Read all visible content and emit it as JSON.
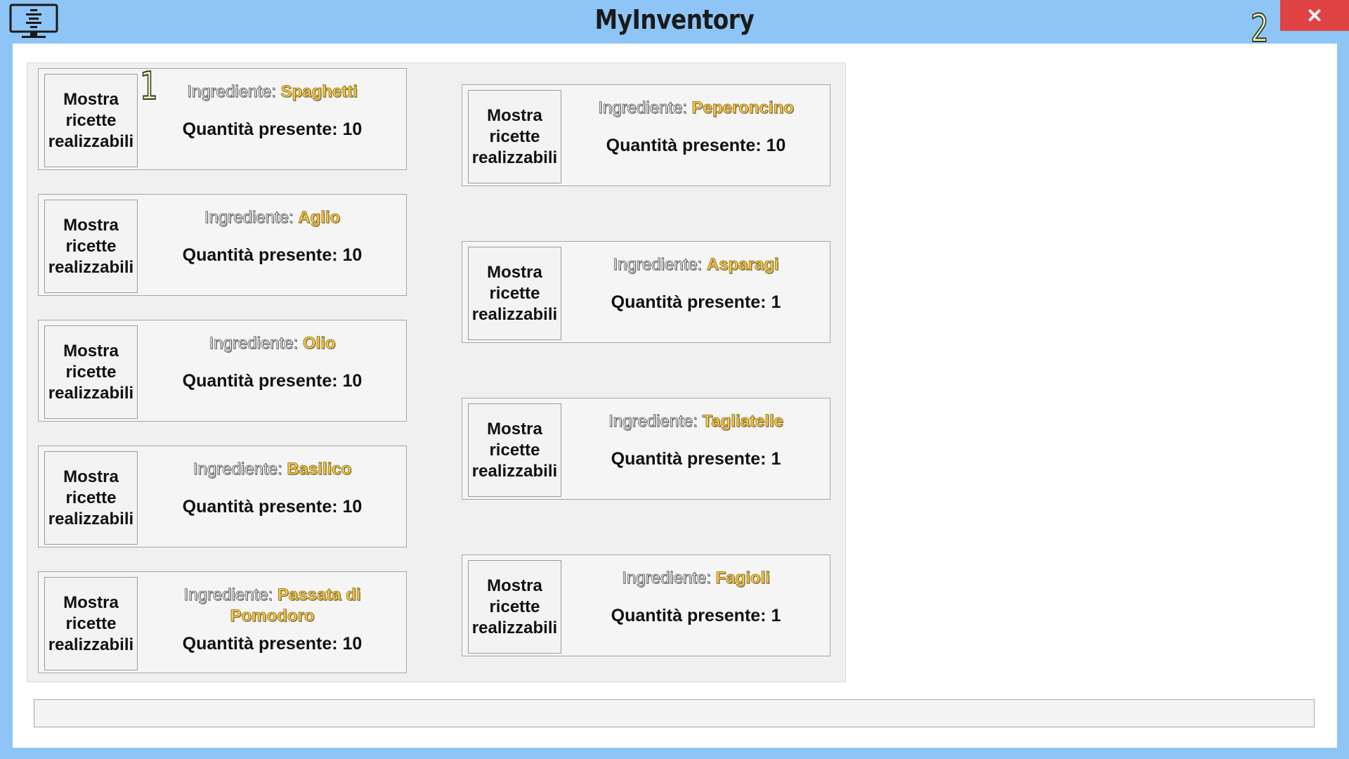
{
  "window": {
    "title": "MyInventory",
    "close_label": "✕",
    "app_icon": "monitor-icon"
  },
  "annotations": [
    "1",
    "2"
  ],
  "colors": {
    "titlebar": "#8ec5f6",
    "close": "#e04343",
    "ingredient_name": "#f5c84a"
  },
  "cards_left": [
    {
      "button": "Mostra ricette realizzabili",
      "label": "Ingrediente: ",
      "name": "Spaghetti",
      "qty": "Quantità presente: 10"
    },
    {
      "button": "Mostra ricette realizzabili",
      "label": "Ingrediente: ",
      "name": "Aglio",
      "qty": "Quantità presente: 10"
    },
    {
      "button": "Mostra ricette realizzabili",
      "label": "Ingrediente: ",
      "name": "Olio",
      "qty": "Quantità presente: 10"
    },
    {
      "button": "Mostra ricette realizzabili",
      "label": "Ingrediente: ",
      "name": "Basilico",
      "qty": "Quantità presente: 10"
    },
    {
      "button": "Mostra ricette realizzabili",
      "label": "Ingrediente: ",
      "name": "Passata di Pomodoro",
      "qty": "Quantità presente: 10"
    }
  ],
  "cards_right": [
    {
      "button": "Mostra ricette realizzabili",
      "label": "Ingrediente: ",
      "name": "Peperoncino",
      "qty": "Quantità presente: 10"
    },
    {
      "button": "Mostra ricette realizzabili",
      "label": "Ingrediente: ",
      "name": "Asparagi",
      "qty": "Quantità presente: 1"
    },
    {
      "button": "Mostra ricette realizzabili",
      "label": "Ingrediente: ",
      "name": "Tagliatelle",
      "qty": "Quantità presente: 1"
    },
    {
      "button": "Mostra ricette realizzabili",
      "label": "Ingrediente: ",
      "name": "Fagioli",
      "qty": "Quantità presente: 1"
    }
  ],
  "status_bar": ""
}
